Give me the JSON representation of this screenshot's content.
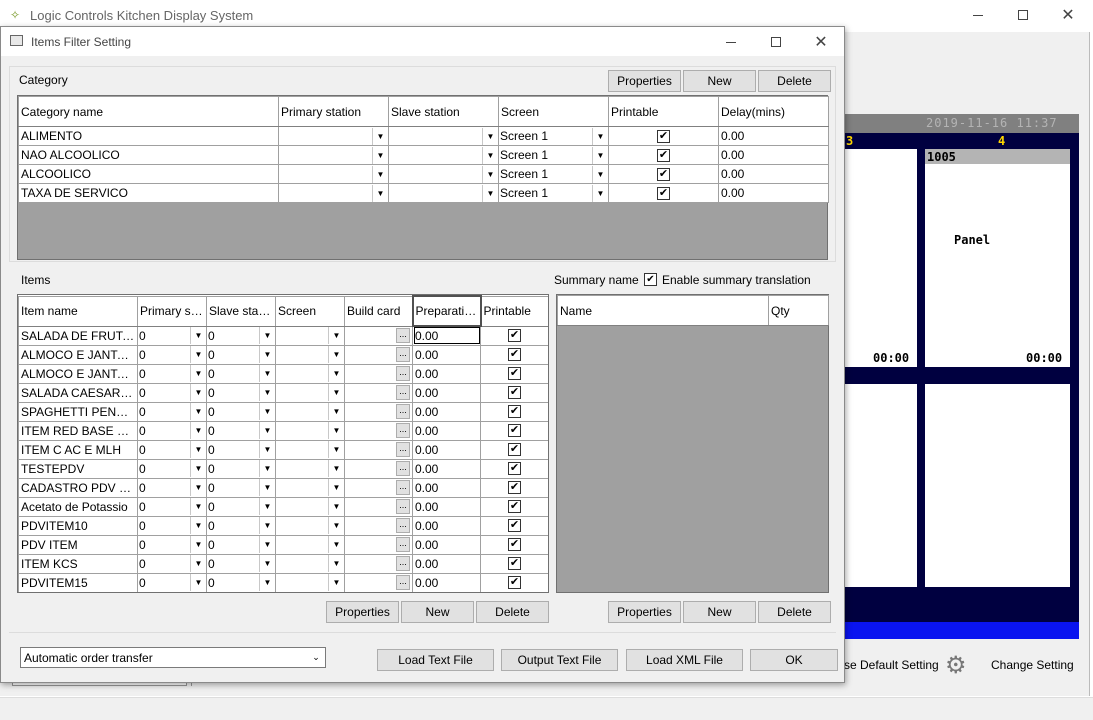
{
  "bg_window": {
    "title": "Logic Controls Kitchen Display System",
    "datetime": "2019-11-16 11:37",
    "column_numbers": [
      "3",
      "4"
    ],
    "order_number": "1005",
    "panel_label": "Panel",
    "timers": [
      "00:00",
      "00:00"
    ],
    "bottom_left_label": "se Default Setting",
    "change_setting_label": "Change Setting"
  },
  "dialog": {
    "title": "Items Filter Setting",
    "category_section_label": "Category",
    "items_section_label": "Items",
    "summary_section_label": "Summary name",
    "enable_summary_label": "Enable summary translation",
    "buttons": {
      "properties": "Properties",
      "new": "New",
      "delete": "Delete"
    },
    "category_columns": [
      "Category name",
      "Primary station",
      "Slave station",
      "Screen",
      "Printable",
      "Delay(mins)"
    ],
    "categories": [
      {
        "name": "ALIMENTO",
        "primary": "",
        "slave": "",
        "screen": "Screen 1",
        "printable": true,
        "delay": "0.00"
      },
      {
        "name": "NAO ALCOOLICO",
        "primary": "",
        "slave": "",
        "screen": "Screen 1",
        "printable": true,
        "delay": "0.00"
      },
      {
        "name": "ALCOOLICO",
        "primary": "",
        "slave": "",
        "screen": "Screen 1",
        "printable": true,
        "delay": "0.00"
      },
      {
        "name": "TAXA DE SERVICO",
        "primary": "",
        "slave": "",
        "screen": "Screen 1",
        "printable": true,
        "delay": "0.00"
      }
    ],
    "item_columns": [
      "Item name",
      "Primary stati...",
      "Slave station",
      "Screen",
      "Build card",
      "Preparation ...",
      "Printable"
    ],
    "items": [
      {
        "name": "SALADA DE FRUTAS",
        "primary": "0",
        "slave": "0",
        "screen": "",
        "prep": "0.00",
        "printable": true
      },
      {
        "name": "ALMOCO E JANTAR ...",
        "primary": "0",
        "slave": "0",
        "screen": "",
        "prep": "0.00",
        "printable": true
      },
      {
        "name": "ALMOCO E JANTAR ...",
        "primary": "0",
        "slave": "0",
        "screen": "",
        "prep": "0.00",
        "printable": true
      },
      {
        "name": "SALADA CAESAR CL...",
        "primary": "0",
        "slave": "0",
        "screen": "",
        "prep": "0.00",
        "printable": true
      },
      {
        "name": "SPAGHETTI PENNE ...",
        "primary": "0",
        "slave": "0",
        "screen": "",
        "prep": "0.00",
        "printable": true
      },
      {
        "name": "ITEM RED BASE DE ...",
        "primary": "0",
        "slave": "0",
        "screen": "",
        "prep": "0.00",
        "printable": true
      },
      {
        "name": "ITEM C AC E MLH",
        "primary": "0",
        "slave": "0",
        "screen": "",
        "prep": "0.00",
        "printable": true
      },
      {
        "name": "TESTEPDV",
        "primary": "0",
        "slave": "0",
        "screen": "",
        "prep": "0.00",
        "printable": true
      },
      {
        "name": "CADASTRO PDV NO...",
        "primary": "0",
        "slave": "0",
        "screen": "",
        "prep": "0.00",
        "printable": true
      },
      {
        "name": "Acetato de Potassio",
        "primary": "0",
        "slave": "0",
        "screen": "",
        "prep": "0.00",
        "printable": true
      },
      {
        "name": "PDVITEM10",
        "primary": "0",
        "slave": "0",
        "screen": "",
        "prep": "0.00",
        "printable": true
      },
      {
        "name": "PDV ITEM",
        "primary": "0",
        "slave": "0",
        "screen": "",
        "prep": "0.00",
        "printable": true
      },
      {
        "name": "ITEM KCS",
        "primary": "0",
        "slave": "0",
        "screen": "",
        "prep": "0.00",
        "printable": true
      },
      {
        "name": "PDVITEM15",
        "primary": "0",
        "slave": "0",
        "screen": "",
        "prep": "0.00",
        "printable": true
      }
    ],
    "summary_columns": [
      "Name",
      "Qty"
    ],
    "transfer_mode": "Automatic order transfer",
    "footer_buttons": {
      "load_text": "Load Text File",
      "output_text": "Output Text File",
      "load_xml": "Load XML File",
      "ok": "OK"
    }
  },
  "glyphs": {
    "check": "✔",
    "arrow": "▼",
    "dots": "..."
  }
}
